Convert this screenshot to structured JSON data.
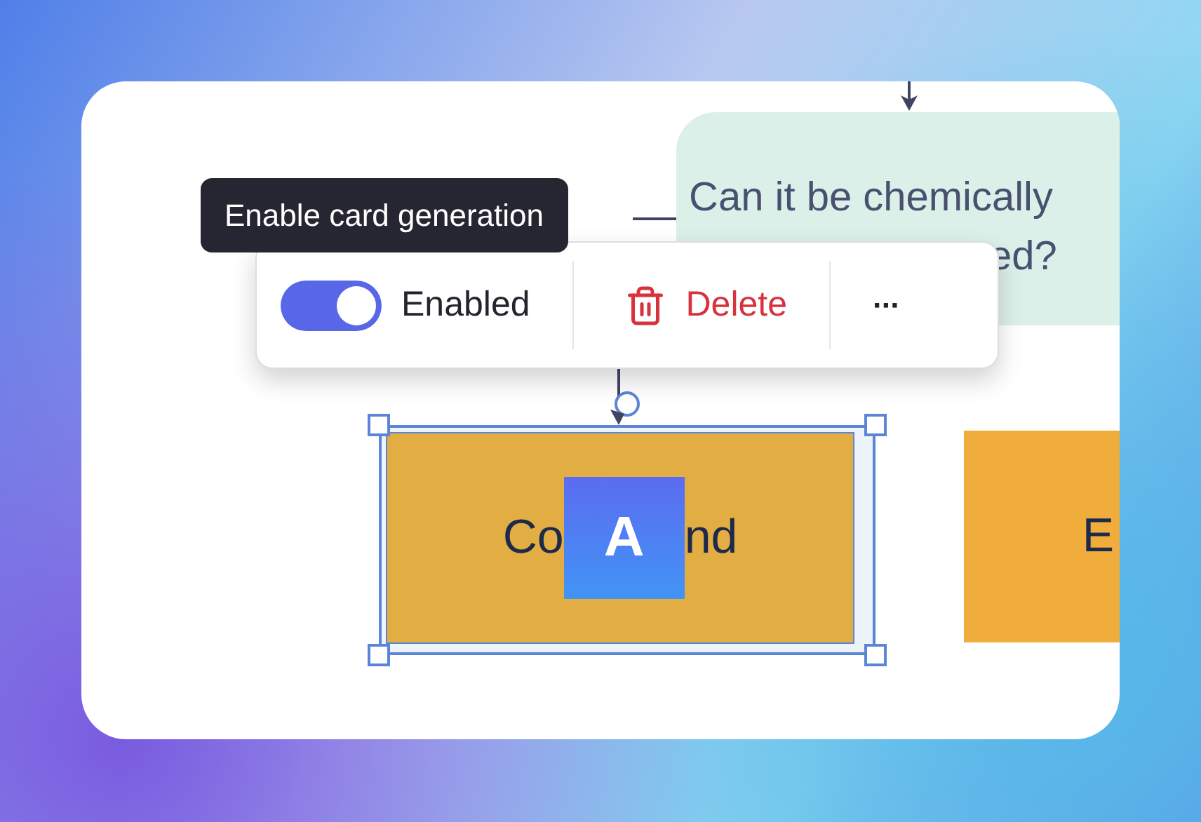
{
  "tooltip": {
    "text": "Enable card generation"
  },
  "toolbar": {
    "toggle": {
      "label": "Enabled",
      "on": true
    },
    "delete": {
      "label": "Delete"
    },
    "more": {
      "label": "···"
    }
  },
  "nodes": [
    {
      "kind": "decision",
      "lines": [
        "Can it be chemically",
        "ed?"
      ],
      "selected": false
    },
    {
      "kind": "process",
      "text_before": "Co",
      "badge": "A",
      "text_after": "nd",
      "selected": true
    },
    {
      "kind": "process",
      "text_before": "E",
      "selected": false
    }
  ]
}
